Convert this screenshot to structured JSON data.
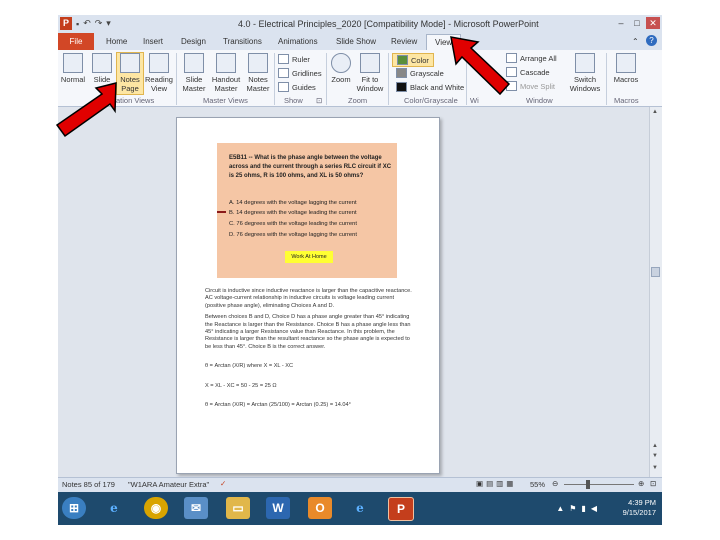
{
  "window": {
    "title": "4.0 - Electrical Principles_2020 [Compatibility Mode] - Microsoft PowerPoint",
    "app_icon": "P"
  },
  "tabs": [
    "File",
    "Home",
    "Insert",
    "Design",
    "Transitions",
    "Animations",
    "Slide Show",
    "Review",
    "View"
  ],
  "active_tab": "View",
  "ribbon": {
    "presentation_views": {
      "normal": "Normal",
      "slide": "Slide",
      "notes_page_1": "Notes",
      "notes_page_2": "Page",
      "reading_1": "Reading",
      "reading_2": "View",
      "group_label": "ation Views"
    },
    "master_views": {
      "slide_master_1": "Slide",
      "slide_master_2": "Master",
      "handout_master_1": "Handout",
      "handout_master_2": "Master",
      "notes_master_1": "Notes",
      "notes_master_2": "Master",
      "group_label": "Master Views"
    },
    "show": {
      "ruler": "Ruler",
      "gridlines": "Gridlines",
      "guides": "Guides",
      "group_label": "Show"
    },
    "zoom": {
      "zoom": "Zoom",
      "fit_1": "Fit to",
      "fit_2": "Window",
      "group_label": "Zoom"
    },
    "color": {
      "color": "Color",
      "grayscale": "Grayscale",
      "bw": "Black and White",
      "group_label": "Color/Grayscale"
    },
    "window": {
      "new_window": "Wi",
      "arrange_all": "Arrange All",
      "cascade": "Cascade",
      "move_split": "Move Split",
      "switch_1": "Switch",
      "switch_2": "Windows",
      "group_label": "Window"
    },
    "macros": {
      "macros": "Macros",
      "group_label": "Macros"
    }
  },
  "slide": {
    "question": "E5B11 -- What is the phase angle between the voltage across and the current through a series RLC circuit if XC is 25 ohms, R is 100 ohms, and XL is 50 ohms?",
    "options": [
      "A.  14 degrees with the voltage lagging the current",
      "B.  14 degrees with the voltage leading the current",
      "C.  76 degrees with the voltage leading the current",
      "D.  76 degrees with the voltage lagging the current"
    ],
    "button": "Work At Home"
  },
  "notes": {
    "p1": "Circuit is inductive since inductive reactance is larger than the capacitive reactance. AC voltage-current relationship in inductive circuits is voltage leading current (positive phase angle), eliminating Choices A and D.",
    "p2": "Between choices B and D, Choice D has a phase angle greater than 45° indicating the Reactance is larger than the Resistance. Choice B has a phase angle less than 45° indicating a larger Resistance value than Reactance. In this problem, the Resistance is larger than the resultant reactance so the phase angle is expected to be less than 45°. Choice B is the correct answer.",
    "f1": "θ = Arctan (X/R) where X = XL - XC",
    "f2": "X = XL - XC = 50 - 25 = 25 Ω",
    "f3": "θ = Arctan (X/R) = Arctan (25/100) = Arctan (0.25) = 14.04°"
  },
  "status": {
    "notes_count": "Notes 85 of 179",
    "theme": "\"W1ARA Amateur Extra\"",
    "zoom_level": "55%"
  },
  "tray": {
    "time": "4:39 PM",
    "date": "9/15/2017"
  },
  "colors": {
    "ribbon_bg": "#f5f7fb",
    "file_tab": "#d24726",
    "slide_bg": "#f5c6a5",
    "arrow": "#e00000",
    "taskbar": "#1e4a6d"
  }
}
